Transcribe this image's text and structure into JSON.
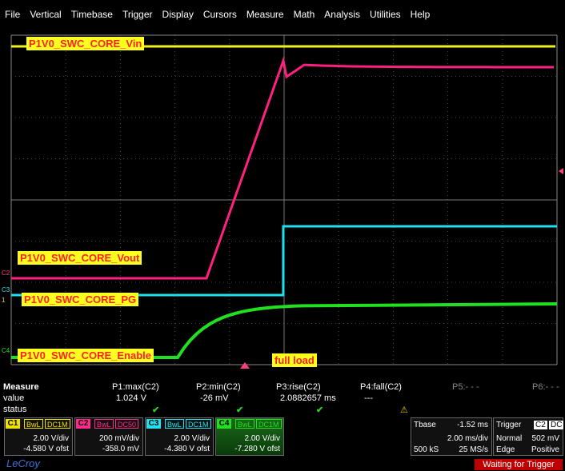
{
  "menu": [
    "File",
    "Vertical",
    "Timebase",
    "Trigger",
    "Display",
    "Cursors",
    "Measure",
    "Math",
    "Analysis",
    "Utilities",
    "Help"
  ],
  "labels": {
    "vin": "P1V0_SWC_CORE_Vin",
    "vout": "P1V0_SWC_CORE_Vout",
    "pg": "P1V0_SWC_CORE_PG",
    "enable": "P1V0_SWC_CORE_Enable",
    "full_load": "full load"
  },
  "markers": {
    "c2": "C2",
    "c3": "C3",
    "c1": "1",
    "c4": "C4"
  },
  "measure": {
    "title": "Measure",
    "row_value": "value",
    "row_status": "status",
    "params": [
      {
        "name": "P1:max(C2)",
        "value": "1.024 V",
        "status": "ok"
      },
      {
        "name": "P2:min(C2)",
        "value": "-26 mV",
        "status": "ok"
      },
      {
        "name": "P3:rise(C2)",
        "value": "2.0882657 ms",
        "status": "ok"
      },
      {
        "name": "P4:fall(C2)",
        "value": "---",
        "status": "warn"
      },
      {
        "name": "P5:- - -",
        "value": "",
        "status": ""
      },
      {
        "name": "P6:- - -",
        "value": "",
        "status": ""
      }
    ]
  },
  "channels": [
    {
      "id": "C1",
      "bw": "BwL",
      "coupling": "DC1M",
      "scale": "2.00 V/div",
      "offset": "-4.580 V ofst",
      "color": "#f0e000"
    },
    {
      "id": "C2",
      "bw": "BwL",
      "coupling": "DC50",
      "scale": "200 mV/div",
      "offset": "-358.0 mV",
      "color": "#ff2a8a"
    },
    {
      "id": "C3",
      "bw": "BwL",
      "coupling": "DC1M",
      "scale": "2.00 V/div",
      "offset": "-4.380 V ofst",
      "color": "#20e0f0"
    },
    {
      "id": "C4",
      "bw": "BwL",
      "coupling": "DC1M",
      "scale": "2.00 V/div",
      "offset": "-7.280 V ofst",
      "color": "#20e020"
    }
  ],
  "timebase": {
    "label": "Tbase",
    "value": "-1.52 ms",
    "div": "2.00 ms/div",
    "samples": "500 kS",
    "rate": "25 MS/s"
  },
  "trigger": {
    "label": "Trigger",
    "chan": "C2",
    "coupling": "DC",
    "mode": "Normal",
    "level": "502 mV",
    "type": "Edge",
    "slope": "Positive"
  },
  "brand": "LeCroy",
  "status_text": "Waiting for Trigger",
  "colors": {
    "vin": "#f0f020",
    "vout": "#ff2080",
    "pg": "#20e0f0",
    "enable": "#20e020"
  }
}
